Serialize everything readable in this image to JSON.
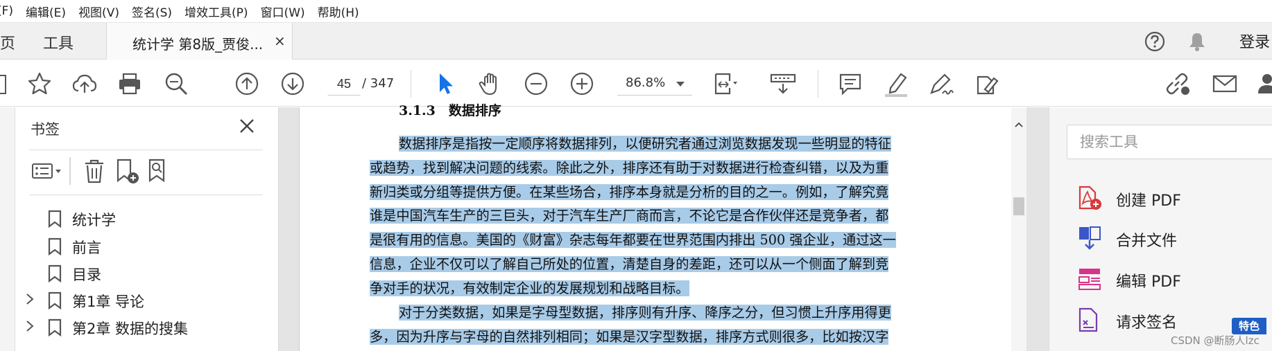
{
  "menu": {
    "items": [
      "(F)",
      "编辑(E)",
      "视图(V)",
      "签名(S)",
      "增效工具(P)",
      "窗口(W)",
      "帮助(H)"
    ]
  },
  "tabs": {
    "home": "页",
    "tools": "工具",
    "document": "统计学 第8版_贾俊...",
    "close": "×",
    "login": "登录"
  },
  "toolbar": {
    "page_current": "45",
    "page_total": "/ 347",
    "zoom": "86.8%"
  },
  "bookmarks": {
    "title": "书签",
    "items": [
      {
        "label": "统计学",
        "expandable": false
      },
      {
        "label": "前言",
        "expandable": false
      },
      {
        "label": "目录",
        "expandable": false
      },
      {
        "label": "第1章 导论",
        "expandable": true
      },
      {
        "label": "第2章 数据的搜集",
        "expandable": true
      }
    ]
  },
  "document": {
    "heading": "3.1.3　数据排序",
    "lines": [
      {
        "text": "数据排序是指按一定顺序将数据排列，以便研究者通过浏览数据发现一些明显的特征",
        "highlight": true
      },
      {
        "text": "或趋势，找到解决问题的线索。除此之外，排序还有助于对数据进行检查纠错，以及为重",
        "highlight": true
      },
      {
        "text": "新归类或分组等提供方便。在某些场合，排序本身就是分析的目的之一。例如，了解究竟",
        "highlight": true
      },
      {
        "text": "谁是中国汽车生产的三巨头，对于汽车生产厂商而言，不论它是合作伙伴还是竞争者，都",
        "highlight": true
      },
      {
        "text": "是很有用的信息。美国的《财富》杂志每年都要在世界范围内排出 500 强企业，通过这一",
        "highlight": true
      },
      {
        "text": "信息，企业不仅可以了解自己所处的位置，清楚自身的差距，还可以从一个侧面了解到竞",
        "highlight": true
      },
      {
        "text": "争对手的状况，有效制定企业的发展规划和战略目标。",
        "highlight": true
      },
      {
        "text": "对于分类数据，如果是字母型数据，排序则有升序、降序之分，但习惯上升序用得更",
        "highlight": true
      },
      {
        "text": "多，因为升序与字母的自然排列相同；如果是汉字型数据，排序方式则很多，比如按汉字",
        "highlight": true
      }
    ]
  },
  "right_pane": {
    "search_placeholder": "搜索工具",
    "tools": [
      {
        "label": "创建 PDF",
        "color": "#d93a3a"
      },
      {
        "label": "合并文件",
        "color": "#3a56c8"
      },
      {
        "label": "编辑 PDF",
        "color": "#d8338a"
      },
      {
        "label": "请求签名",
        "color": "#7a3bb0"
      }
    ],
    "badge": "特色",
    "watermark": "CSDN @断肠人lzc"
  },
  "colors": {
    "highlight": "#a8cbe8",
    "cursor_blue": "#1473e6"
  }
}
